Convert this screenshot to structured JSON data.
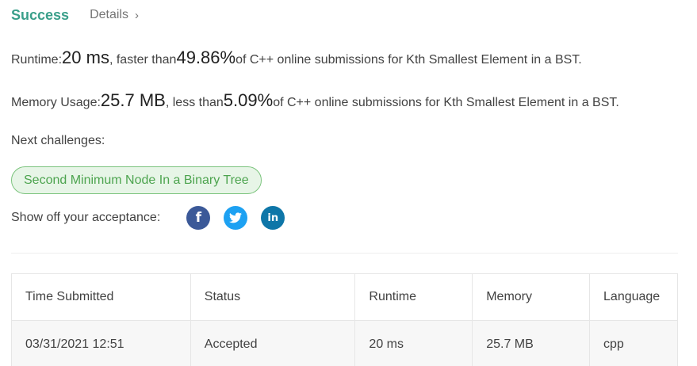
{
  "header": {
    "status": "Success",
    "details_label": "Details",
    "details_chevron": "›"
  },
  "runtime_line": {
    "label": "Runtime: ",
    "value": "20 ms",
    "mid_text": ", faster than ",
    "percent": "49.86%",
    "suffix": " of C++ online submissions for Kth Smallest Element in a BST."
  },
  "memory_line": {
    "label": "Memory Usage: ",
    "value": "25.7 MB",
    "mid_text": ", less than ",
    "percent": "5.09%",
    "suffix": " of C++ online submissions for Kth Smallest Element in a BST."
  },
  "next_challenges": {
    "label": "Next challenges:",
    "items": [
      "Second Minimum Node In a Binary Tree"
    ]
  },
  "share": {
    "label": "Show off your acceptance:",
    "icons": [
      "facebook-icon",
      "twitter-icon",
      "linkedin-icon"
    ]
  },
  "submissions_table": {
    "headers": [
      "Time Submitted",
      "Status",
      "Runtime",
      "Memory",
      "Language"
    ],
    "rows": [
      {
        "time": "03/31/2021 12:51",
        "status": "Accepted",
        "runtime": "20 ms",
        "memory": "25.7 MB",
        "language": "cpp"
      }
    ]
  },
  "colors": {
    "success": "#3a9f8a",
    "chip_border": "#7cc47e",
    "chip_bg": "#e7f5e7",
    "facebook": "#3b5998",
    "twitter": "#1da1f2",
    "linkedin": "#0e76a8"
  }
}
